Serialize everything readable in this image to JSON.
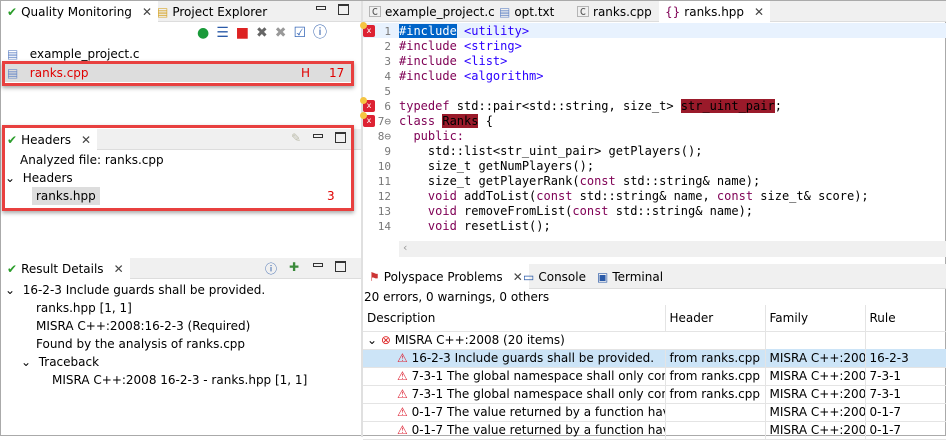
{
  "left_top": {
    "tabs": [
      {
        "label": "Quality Monitoring",
        "icon": "check-icon"
      },
      {
        "label": "Project Explorer",
        "icon": "folder-icon"
      }
    ],
    "toolbar": [
      "run-icon",
      "list-icon",
      "stop-icon",
      "delete-icon",
      "delete-all-icon",
      "clipboard-check-icon",
      "help-icon"
    ],
    "files": [
      {
        "name": "example_project.c"
      },
      {
        "name": "ranks.cpp",
        "flag": "H",
        "count": "17"
      }
    ]
  },
  "headers_panel": {
    "title": "Headers",
    "analyzed": "Analyzed file: ranks.cpp",
    "group": "Headers",
    "items": [
      {
        "name": "ranks.hpp",
        "count": "3"
      }
    ]
  },
  "result_details": {
    "title": "Result Details",
    "items": [
      "16-2-3 Include guards shall be provided.",
      "ranks.hpp [1, 1]",
      "MISRA C++:2008:16-2-3 (Required)",
      "Found by the analysis of ranks.cpp",
      "Traceback",
      "MISRA C++:2008 16-2-3 - ranks.hpp [1, 1]"
    ]
  },
  "editor": {
    "tabs": [
      "example_project.c",
      "opt.txt",
      "ranks.cpp",
      "ranks.hpp"
    ],
    "active_tab": 3,
    "lines": [
      [
        [
          "#include",
          "hl"
        ],
        [
          " "
        ],
        [
          "<utility>",
          "str"
        ]
      ],
      [
        [
          "#include",
          "kw"
        ],
        [
          " "
        ],
        [
          "<string>",
          "str"
        ]
      ],
      [
        [
          "#include",
          "kw"
        ],
        [
          " "
        ],
        [
          "<list>",
          "str"
        ]
      ],
      [
        [
          "#include",
          "kw"
        ],
        [
          " "
        ],
        [
          "<algorithm>",
          "str"
        ]
      ],
      [],
      [
        [
          "typedef",
          "kw"
        ],
        [
          " std::pair<std::string, size_t> "
        ],
        [
          "str_uint_pair",
          "err"
        ],
        [
          ";"
        ]
      ],
      [
        [
          "class",
          "kw"
        ],
        [
          " "
        ],
        [
          "Ranks",
          "err"
        ],
        [
          " {"
        ]
      ],
      [
        [
          "  public:",
          "kw"
        ]
      ],
      [
        [
          "    std::list<str_uint_pair> getPlayers();"
        ]
      ],
      [
        [
          "    size_t getNumPlayers();"
        ]
      ],
      [
        [
          "    size_t getPlayerRank("
        ],
        [
          "const",
          "kw"
        ],
        [
          " std::string& name);"
        ]
      ],
      [
        [
          "    "
        ],
        [
          "void",
          "kw"
        ],
        [
          " addToList("
        ],
        [
          "const",
          "kw"
        ],
        [
          " std::string& name, "
        ],
        [
          "const",
          "kw"
        ],
        [
          " size_t& score);"
        ]
      ],
      [
        [
          "    "
        ],
        [
          "void",
          "kw"
        ],
        [
          " removeFromList("
        ],
        [
          "const",
          "kw"
        ],
        [
          " std::string& name);"
        ]
      ],
      [
        [
          "    "
        ],
        [
          "void",
          "kw"
        ],
        [
          " resetList();"
        ]
      ]
    ]
  },
  "problems": {
    "tabs": [
      "Polyspace Problems",
      "Console",
      "Terminal"
    ],
    "summary": "20 errors, 0 warnings, 0 others",
    "columns": [
      "Description",
      "Header",
      "Family",
      "Rule"
    ],
    "group": "MISRA C++:2008 (20 items)",
    "rows": [
      [
        "16-2-3 Include guards shall be provided.",
        "from ranks.cpp",
        "MISRA C++:2008",
        "16-2-3"
      ],
      [
        "7-3-1 The global namespace shall only contain",
        "from ranks.cpp",
        "MISRA C++:2008",
        "7-3-1"
      ],
      [
        "7-3-1 The global namespace shall only contain",
        "from ranks.cpp",
        "MISRA C++:2008",
        "7-3-1"
      ],
      [
        "0-1-7 The value returned by a function having",
        "",
        "MISRA C++:2008",
        "0-1-7"
      ],
      [
        "0-1-7 The value returned by a function having",
        "",
        "MISRA C++:2008",
        "0-1-7"
      ]
    ]
  },
  "colors": {
    "highlight_box": "#e8403f",
    "error_text": "#e00000",
    "selection": "#cce4f7",
    "keyword": "#7f0055",
    "string": "#2a00ff"
  }
}
